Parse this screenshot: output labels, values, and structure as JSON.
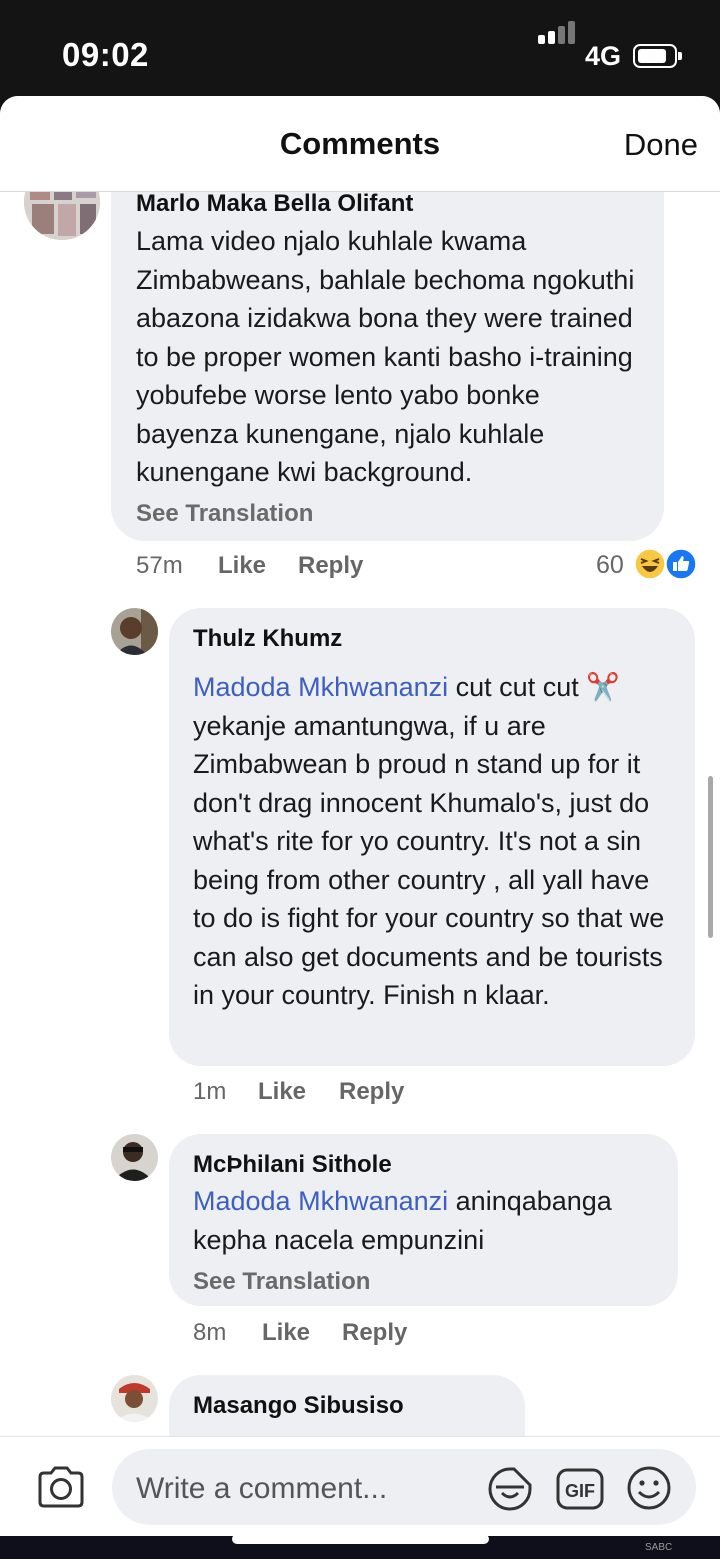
{
  "status_bar": {
    "time": "09:02",
    "network": "4G"
  },
  "header": {
    "title": "Comments",
    "done_label": "Done"
  },
  "comments": [
    {
      "name": "Marlo Maka Bella Olifant",
      "text": "Lama video njalo kuhlale kwama Zimbabweans, bahlale bechoma ngokuthi abazona izidakwa bona they were trained to be proper women kanti basho i-training yobufebe worse lento yabo bonke bayenza kunengane, njalo kuhlale kunengane kwi background.",
      "see_translation": "See Translation",
      "time": "57m",
      "like": "Like",
      "reply": "Reply",
      "reaction_count": "60",
      "reaction_icons": [
        "haha-icon",
        "like-icon"
      ]
    },
    {
      "name": "Thulz Khumz",
      "mention": "Madoda Mkhwananzi",
      "text": " cut cut cut ✂️ yekanje amantungwa, if u are Zimbabwean b proud n stand up for it don't drag innocent Khumalo's, just do what's rite for yo country. It's not a sin being from other country , all yall have to do is fight for your country so that we can also get documents and be tourists in your country. Finish n klaar.",
      "time": "1m",
      "like": "Like",
      "reply": "Reply"
    },
    {
      "name": "McÞhilani Sithole",
      "mention": "Madoda Mkhwananzi",
      "text": "  aninqabanga kepha nacela empunzini",
      "see_translation": "See Translation",
      "time": "8m",
      "like": "Like",
      "reply": "Reply"
    },
    {
      "name": "Masango Sibusiso"
    }
  ],
  "composer": {
    "placeholder": "Write a comment...",
    "icons": [
      "camera-icon",
      "sticker-icon",
      "gif-icon",
      "emoji-icon"
    ],
    "gif_label": "GIF"
  },
  "watermark": "SABC"
}
